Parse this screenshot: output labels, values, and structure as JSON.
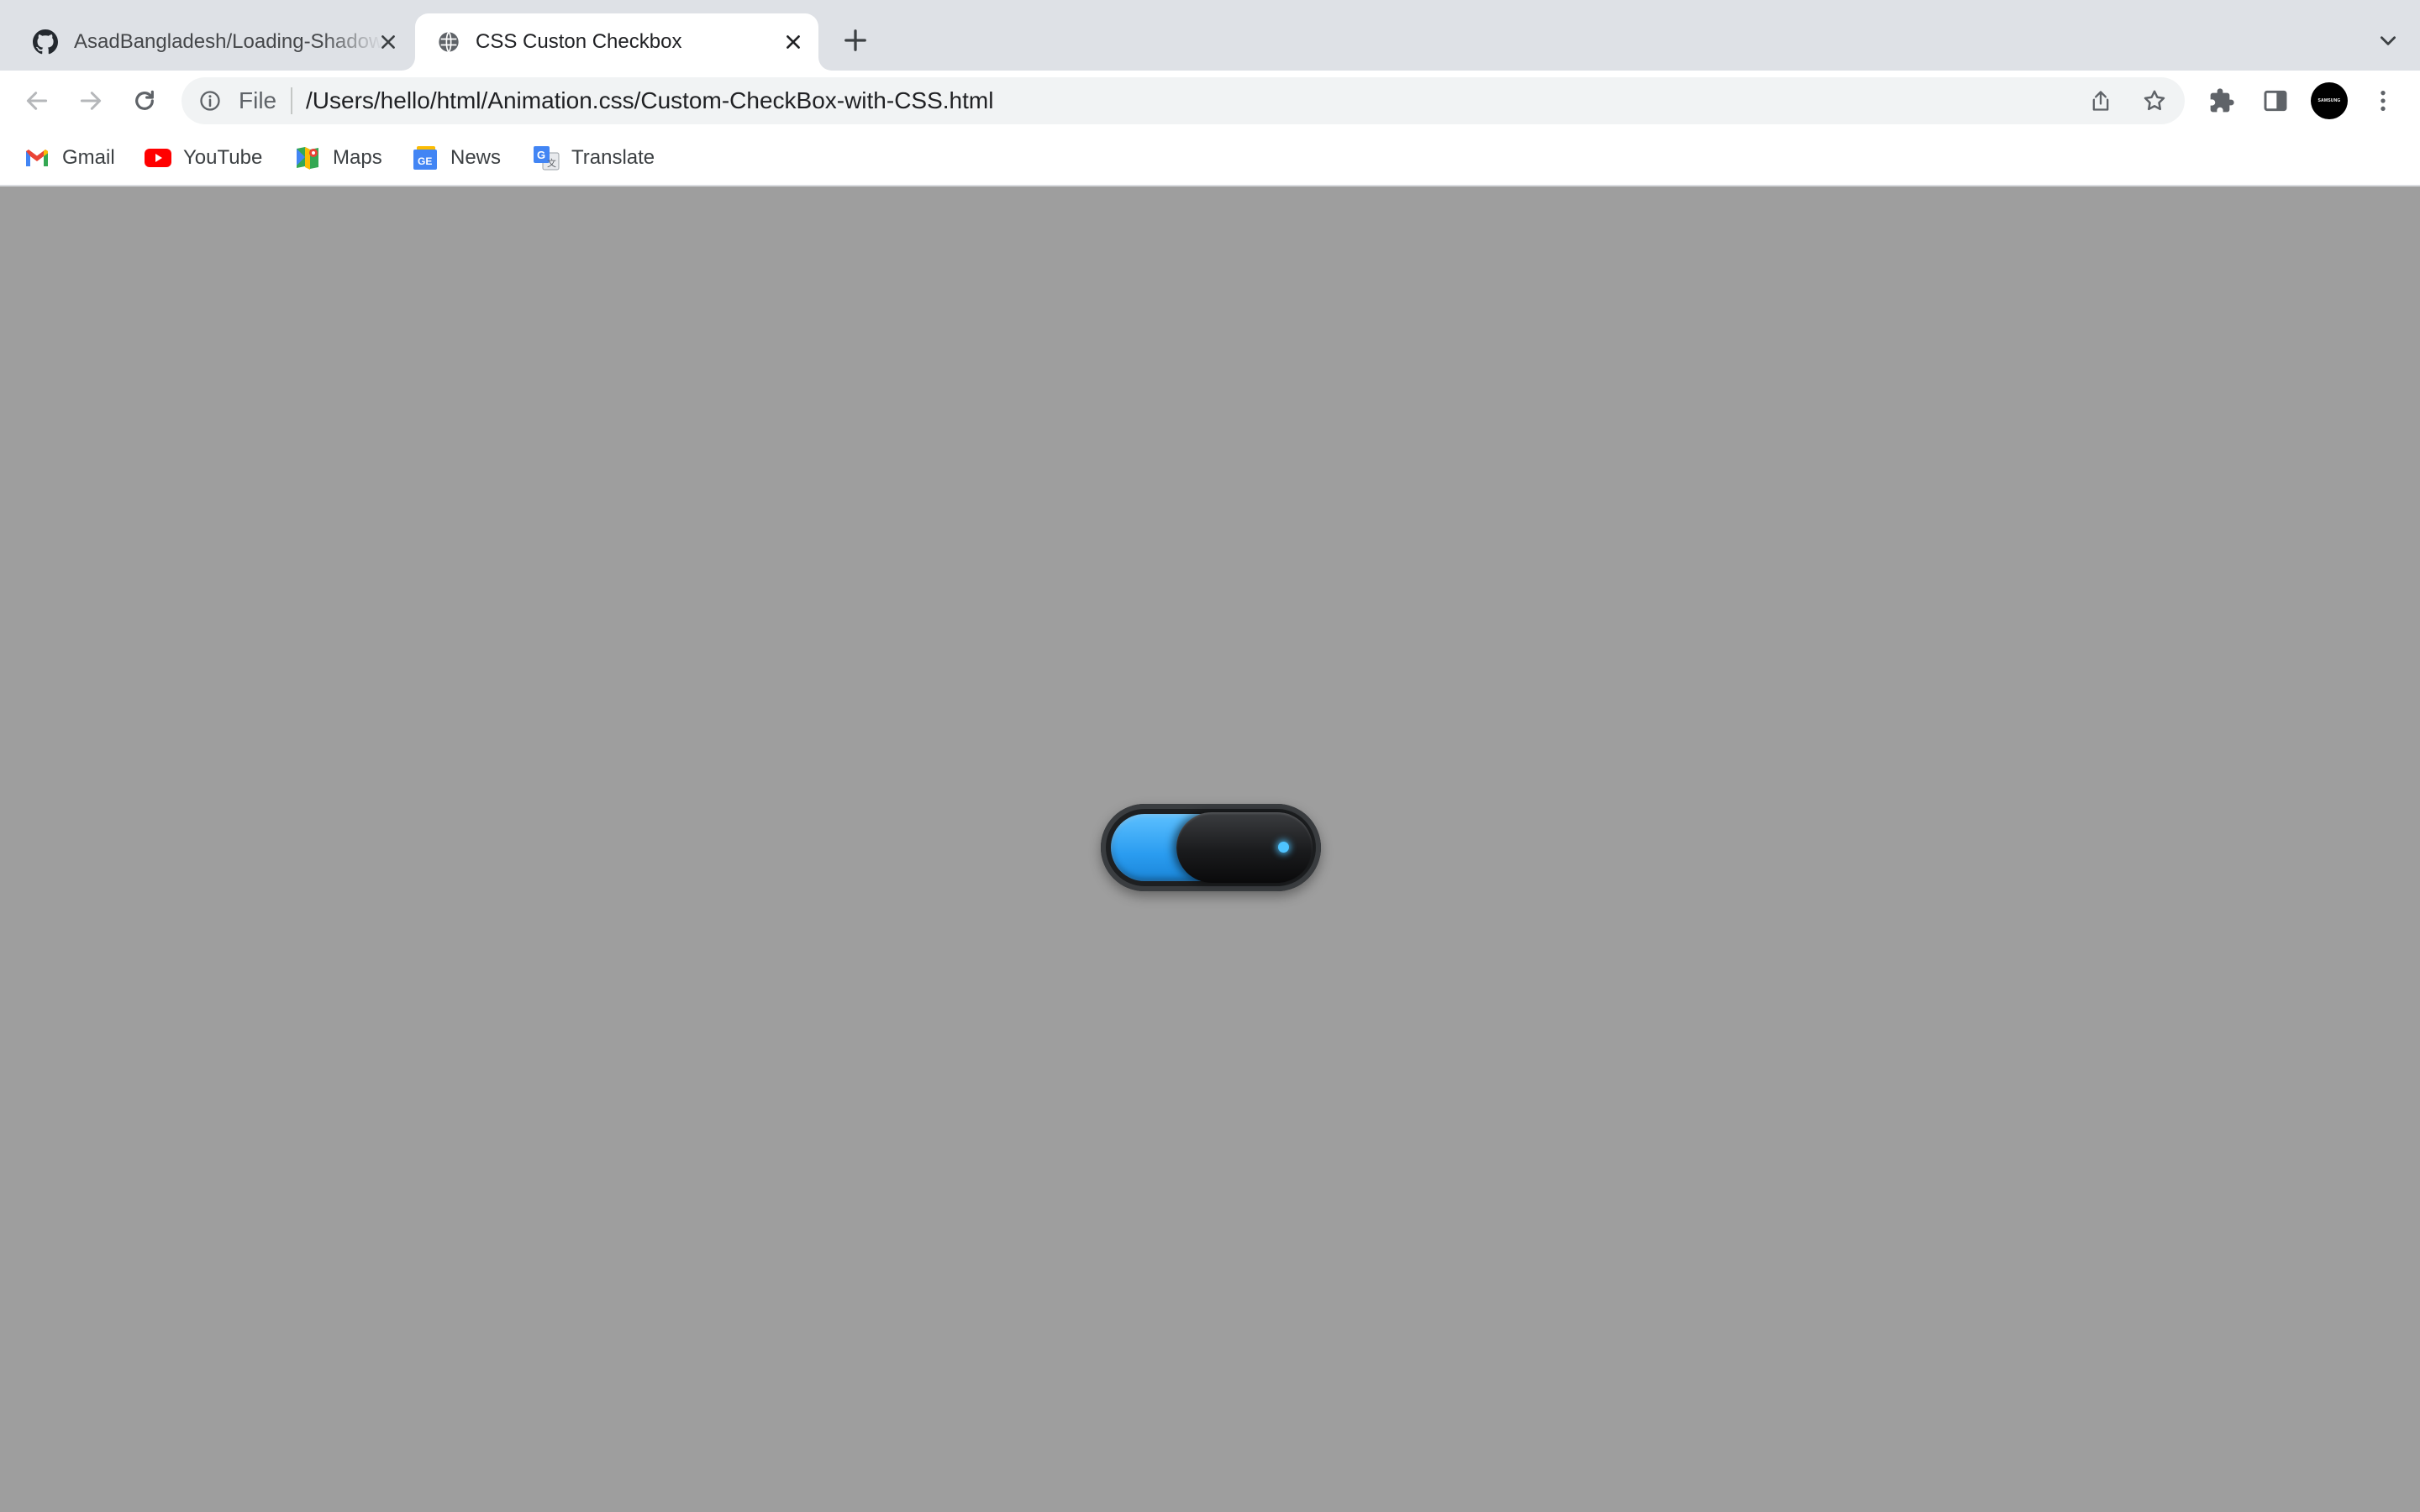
{
  "browser": {
    "tabs": [
      {
        "title": "AsadBangladesh/Loading-Shadow",
        "favicon": "github-icon",
        "active": false
      },
      {
        "title": "CSS Custon Checkbox",
        "favicon": "globe-icon",
        "active": true
      }
    ],
    "address_bar": {
      "scheme_label": "File",
      "url": "/Users/hello/html/Animation.css/Custom-CheckBox-with-CSS.html"
    },
    "profile_avatar_text": "SAMSUNG",
    "bookmarks": [
      {
        "label": "Gmail",
        "icon": "gmail-icon"
      },
      {
        "label": "YouTube",
        "icon": "youtube-icon"
      },
      {
        "label": "Maps",
        "icon": "maps-icon"
      },
      {
        "label": "News",
        "icon": "news-icon"
      },
      {
        "label": "Translate",
        "icon": "translate-icon"
      }
    ]
  },
  "page": {
    "background_color": "#9e9e9e",
    "toggle": {
      "checked": true,
      "track_color": "#2a9cf0",
      "knob_color": "#1a1b1d",
      "indicator_color": "#4ec3ff"
    }
  }
}
